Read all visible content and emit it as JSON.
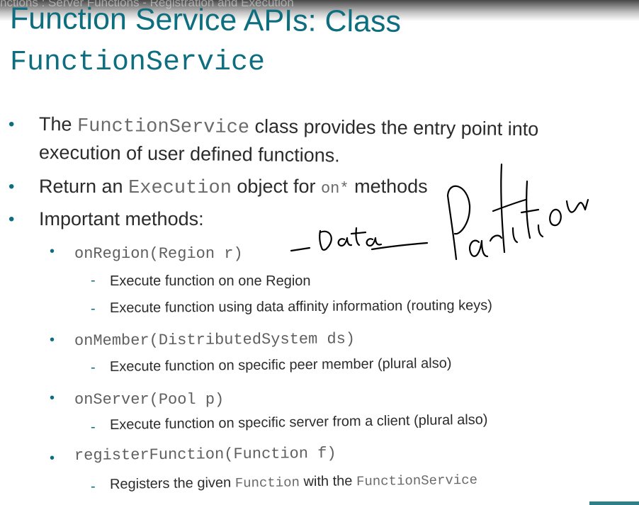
{
  "header": {
    "breadcrumb": "nctions : Server Functions - Registration and Execution"
  },
  "title": {
    "line1": "Function Service APIs: Class",
    "line2": "FunctionService"
  },
  "bullets": {
    "b1_pre": "The ",
    "b1_code": "FunctionService",
    "b1_post": " class provides the entry point into",
    "b1_line2": "execution of user defined functions.",
    "b2_pre": "Return an ",
    "b2_code": "Execution",
    "b2_mid": " object for ",
    "b2_code2": "on*",
    "b2_post": "  methods",
    "b3": "Important methods:"
  },
  "methods": [
    {
      "signature_name": "onRegion",
      "signature_args": "(Region r)",
      "details": [
        "Execute function on one Region",
        "Execute function using data affinity information (routing keys)"
      ]
    },
    {
      "signature_name": "onMember",
      "signature_args": "(DistributedSystem ds)",
      "details": [
        "Execute function on specific peer member (plural also)"
      ]
    },
    {
      "signature_name": "onServer",
      "signature_args": "(Pool p)",
      "details": [
        "Execute function on specific server from a client (plural also)"
      ]
    },
    {
      "signature_name": "registerFunction",
      "signature_args": "(Function f)",
      "details_rich": {
        "pre": "Registers the given ",
        "code1": "Function",
        "mid": " with the ",
        "code2": "FunctionService"
      }
    }
  ],
  "handwriting": {
    "word1": "Data",
    "word2": "Partition"
  },
  "colors": {
    "title": "#0c6e7e",
    "text": "#2b2b2b",
    "code": "#6a6a6a",
    "ink": "#000000"
  }
}
